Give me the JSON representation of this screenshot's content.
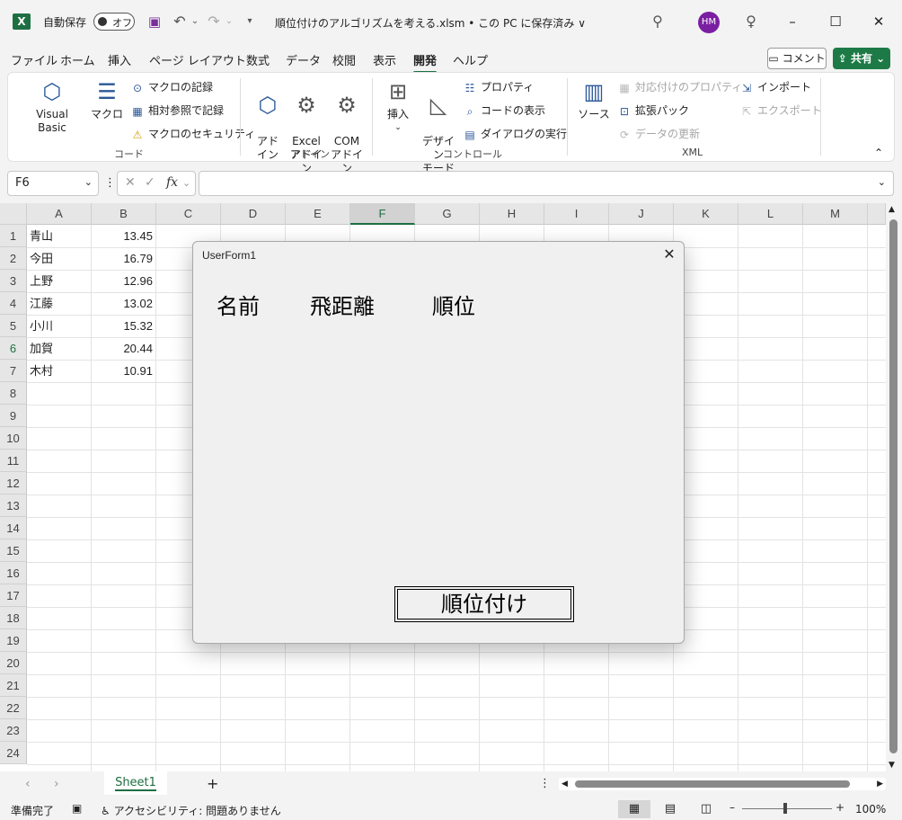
{
  "titlebar": {
    "app_logo": "X",
    "autosave_label": "自動保存",
    "autosave_state": "オフ",
    "document_title": "順位付けのアルゴリズムを考える.xlsm • この PC に保存済み ∨",
    "user_initials": "HM"
  },
  "ribbon_tabs": [
    "ファイル",
    "ホーム",
    "挿入",
    "ページ レイアウト",
    "数式",
    "データ",
    "校閲",
    "表示",
    "開発",
    "ヘルプ"
  ],
  "active_tab": "開発",
  "header_actions": {
    "comment": "コメント",
    "share": "共有"
  },
  "ribbon": {
    "code": {
      "label": "コード",
      "visual_basic": "Visual Basic",
      "macro": "マクロ",
      "record_macro": "マクロの記録",
      "relative_ref": "相対参照で記録",
      "macro_security": "マクロのセキュリティ"
    },
    "addins": {
      "label": "アドイン",
      "addin": "アド\nイン",
      "excel_addin": "Excel\nアドイン",
      "com_addin": "COM\nアドイン"
    },
    "controls": {
      "label": "コントロール",
      "insert": "挿入",
      "design_mode": "デザイン\nモード",
      "properties": "プロパティ",
      "view_code": "コードの表示",
      "run_dialog": "ダイアログの実行"
    },
    "xml": {
      "label": "XML",
      "source": "ソース",
      "map_properties": "対応付けのプロパティ",
      "expansion_packs": "拡張パック",
      "refresh_data": "データの更新",
      "import": "インポート",
      "export": "エクスポート"
    }
  },
  "formula_bar": {
    "name_box": "F6",
    "fx": "fx",
    "formula": ""
  },
  "columns": [
    "A",
    "B",
    "C",
    "D",
    "E",
    "F",
    "G",
    "H",
    "I",
    "J",
    "K",
    "L",
    "M"
  ],
  "selected_column": "F",
  "rows": [
    "1",
    "2",
    "3",
    "4",
    "5",
    "6",
    "7",
    "8",
    "9",
    "10",
    "11",
    "12",
    "13",
    "14",
    "15",
    "16",
    "17",
    "18",
    "19",
    "20",
    "21",
    "22",
    "23",
    "24"
  ],
  "selected_row": "6",
  "cells": [
    {
      "name": "青山",
      "value": "13.45"
    },
    {
      "name": "今田",
      "value": "16.79"
    },
    {
      "name": "上野",
      "value": "12.96"
    },
    {
      "name": "江藤",
      "value": "13.02"
    },
    {
      "name": "小川",
      "value": "15.32"
    },
    {
      "name": "加賀",
      "value": "20.44"
    },
    {
      "name": "木村",
      "value": "10.91"
    }
  ],
  "sheet_tabs": {
    "active": "Sheet1",
    "add": "+"
  },
  "statusbar": {
    "ready": "準備完了",
    "accessibility": "アクセシビリティ: 問題ありません",
    "zoom": "100%"
  },
  "userform": {
    "title": "UserForm1",
    "labels": [
      "名前",
      "飛距離",
      "順位"
    ],
    "button": "順位付け"
  }
}
